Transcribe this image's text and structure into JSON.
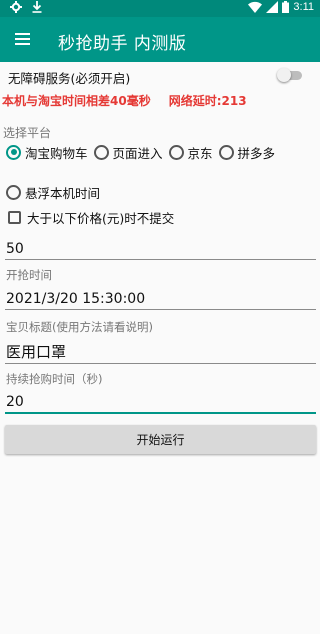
{
  "status_bar": {
    "time": "3:11",
    "icons": [
      "settings-icon",
      "download-icon",
      "wifi-icon",
      "signal-icon",
      "battery-icon"
    ]
  },
  "app_bar": {
    "title": "秒抢助手 内测版",
    "menu_icon": "menu-icon"
  },
  "accessibility": {
    "label": "无障碍服务(必须开启)",
    "enabled": false
  },
  "time_info": {
    "diff_text": "本机与淘宝时间相差40毫秒",
    "latency_text": "网络延时:213"
  },
  "platform": {
    "label": "选择平台",
    "options": [
      "淘宝购物车",
      "页面进入",
      "京东",
      "拼多多"
    ],
    "selected": "淘宝购物车"
  },
  "float_time": {
    "label": "悬浮本机时间",
    "checked": false
  },
  "price_limit": {
    "label": "大于以下价格(元)时不提交",
    "checked": false,
    "value": "50"
  },
  "start_time": {
    "hint": "开抢时间",
    "value": "2021/3/20 15:30:00"
  },
  "item_title": {
    "hint": "宝贝标题(使用方法请看说明)",
    "value": "医用口罩"
  },
  "duration": {
    "hint": "持续抢购时间（秒)",
    "value": "20"
  },
  "run_button": {
    "label": "开始运行"
  },
  "colors": {
    "primary": "#009688",
    "primary_dark": "#00897b",
    "alert": "#e53935"
  }
}
